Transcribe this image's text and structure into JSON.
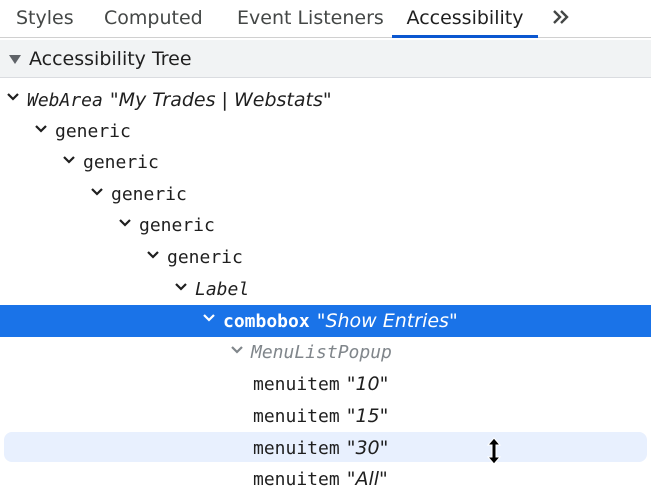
{
  "tabs": [
    {
      "label": "Styles",
      "active": false
    },
    {
      "label": "Computed",
      "active": false
    },
    {
      "label": "Event Listeners",
      "active": false
    },
    {
      "label": "Accessibility",
      "active": true
    }
  ],
  "tab_overflow_icon": "double-chevron-right-icon",
  "section": {
    "title": "Accessibility Tree",
    "expanded": true
  },
  "tree": [
    {
      "role": "WebArea",
      "name": "My Trades | Webstats",
      "depth": 0,
      "expanded": true,
      "style": "italic"
    },
    {
      "role": "generic",
      "name": "",
      "depth": 1,
      "expanded": true,
      "style": "normal"
    },
    {
      "role": "generic",
      "name": "",
      "depth": 2,
      "expanded": true,
      "style": "normal"
    },
    {
      "role": "generic",
      "name": "",
      "depth": 3,
      "expanded": true,
      "style": "normal"
    },
    {
      "role": "generic",
      "name": "",
      "depth": 4,
      "expanded": true,
      "style": "normal"
    },
    {
      "role": "generic",
      "name": "",
      "depth": 5,
      "expanded": true,
      "style": "normal"
    },
    {
      "role": "Label",
      "name": "",
      "depth": 6,
      "expanded": true,
      "style": "italic"
    },
    {
      "role": "combobox",
      "name": "Show Entries",
      "depth": 7,
      "expanded": true,
      "style": "bold",
      "selected": true
    },
    {
      "role": "MenuListPopup",
      "name": "",
      "depth": 8,
      "expanded": true,
      "style": "muted"
    },
    {
      "role": "menuitem",
      "name": "10",
      "depth": 9,
      "leaf": true,
      "style": "normal"
    },
    {
      "role": "menuitem",
      "name": "15",
      "depth": 9,
      "leaf": true,
      "style": "normal"
    },
    {
      "role": "menuitem",
      "name": "30",
      "depth": 9,
      "leaf": true,
      "style": "normal",
      "hovered": true
    },
    {
      "role": "menuitem",
      "name": "All",
      "depth": 9,
      "leaf": true,
      "style": "normal"
    }
  ],
  "colors": {
    "accent": "#0b57d0",
    "selection": "#1a73e8",
    "hover": "#e8f0fe",
    "header_bg": "#f1f3f4"
  },
  "cursor_icon": "vertical-resize-cursor-icon"
}
